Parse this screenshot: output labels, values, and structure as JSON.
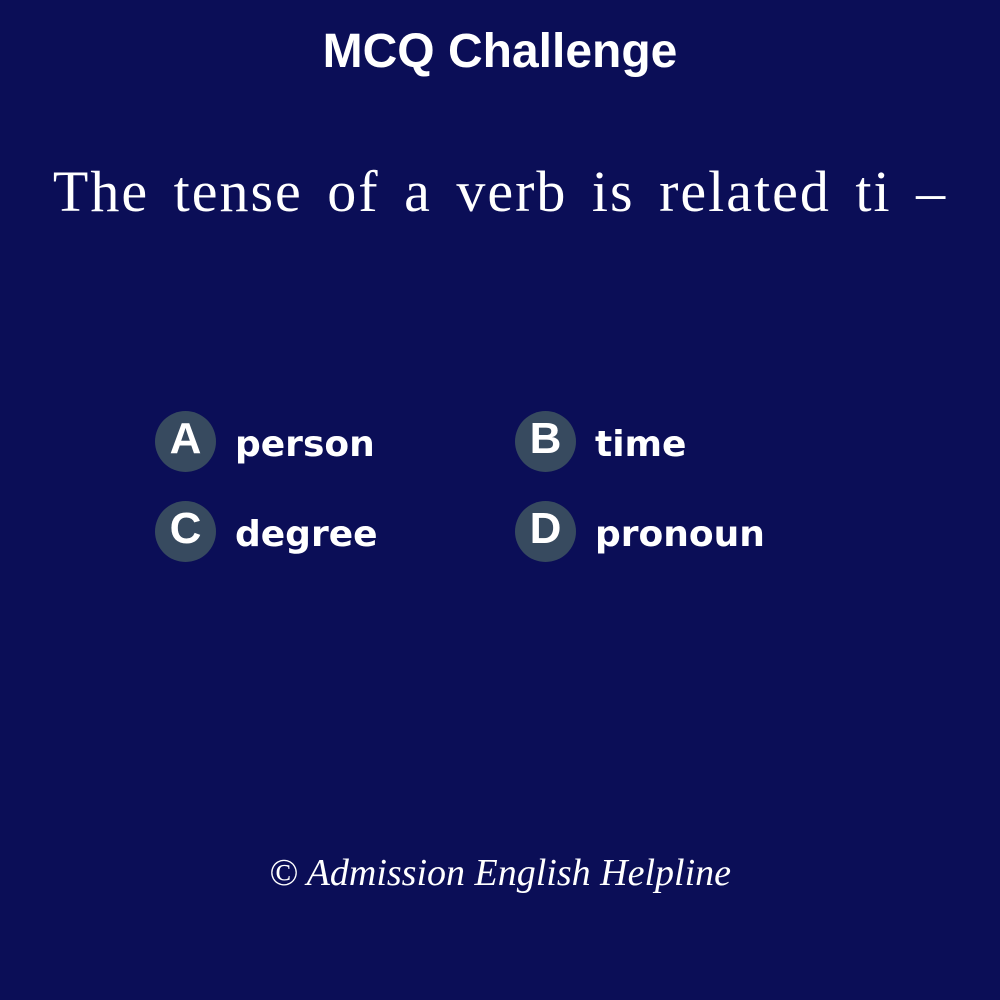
{
  "header": {
    "title": "MCQ Challenge"
  },
  "question": {
    "text": "The tense of a verb is related ti –"
  },
  "options": [
    {
      "letter": "A",
      "text": "person"
    },
    {
      "letter": "B",
      "text": "time"
    },
    {
      "letter": "C",
      "text": "degree"
    },
    {
      "letter": "D",
      "text": "pronoun"
    }
  ],
  "footer": {
    "credit": "© Admission English Helpline"
  },
  "colors": {
    "background": "#0b0e57",
    "badge": "#374a5f",
    "text": "#ffffff"
  }
}
